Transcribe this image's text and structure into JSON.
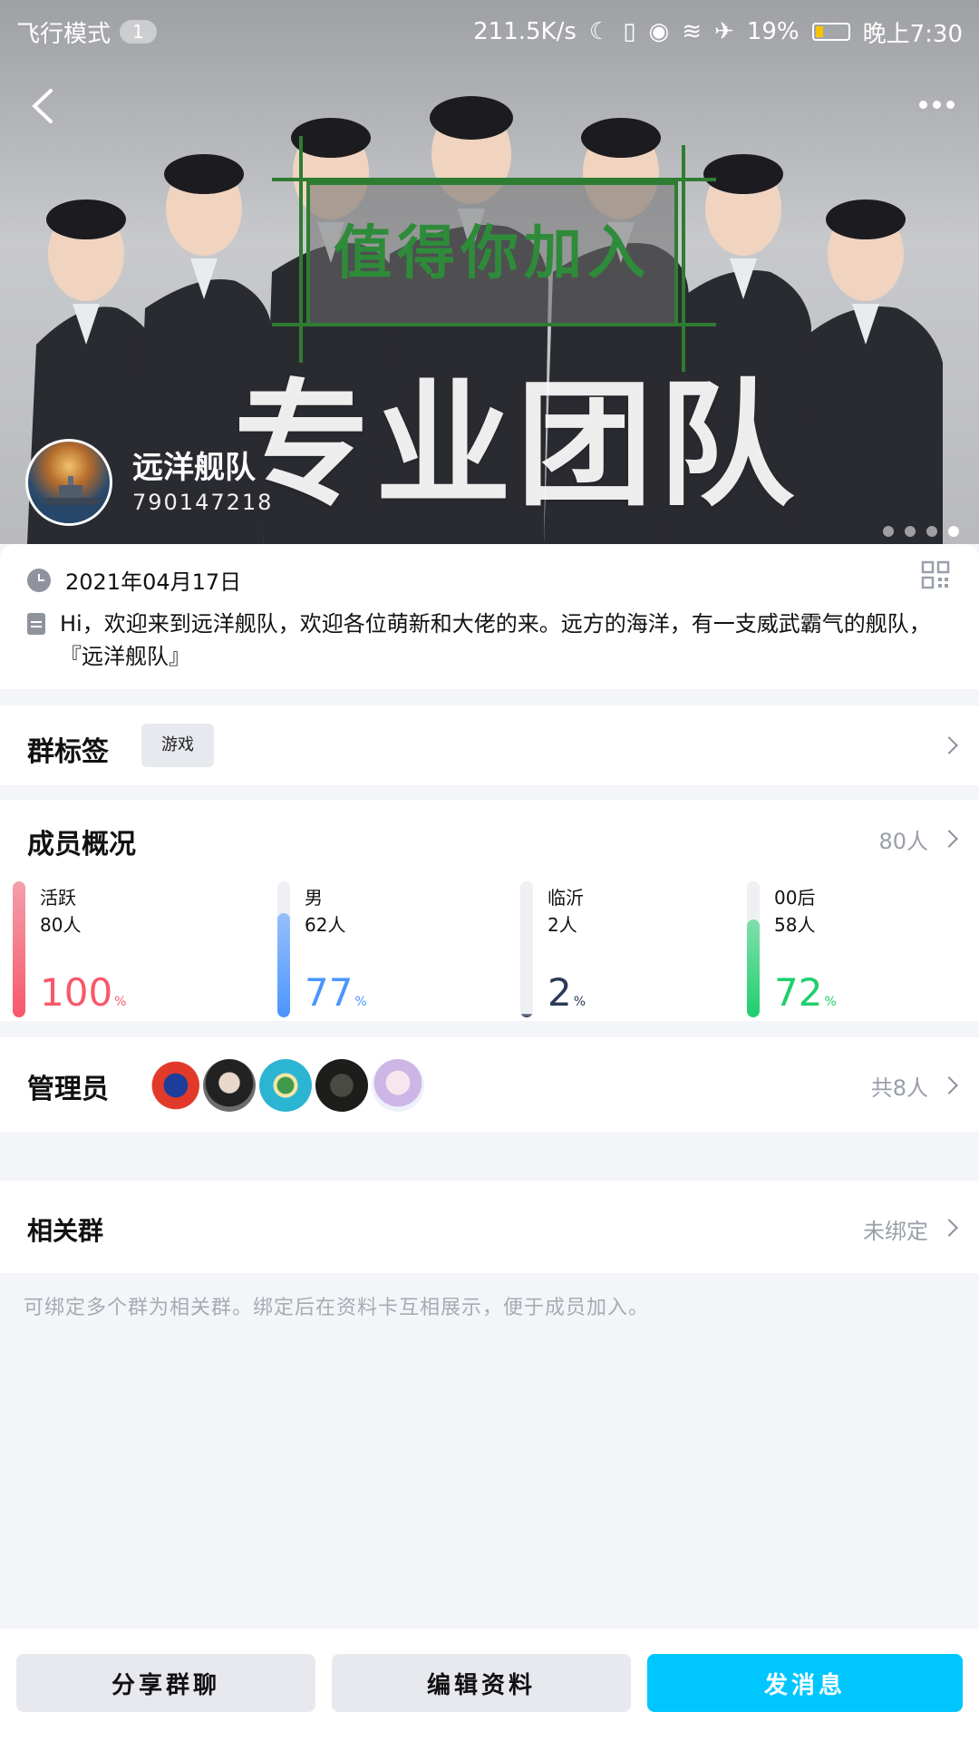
{
  "status_bar": {
    "mode_label": "飞行模式",
    "mode_badge": "1",
    "net_speed": "211.5K/s",
    "battery": "19%",
    "time": "晚上7:30"
  },
  "hero": {
    "banner_text": "值得你加入",
    "big_text": "专业团队",
    "page_dots": 4,
    "active_dot": 4
  },
  "group": {
    "name": "远洋舰队",
    "id": "790147218"
  },
  "info": {
    "date": "2021年04月17日",
    "description": "Hi，欢迎来到远洋舰队，欢迎各位萌新和大佬的来。远方的海洋，有一支威武霸气的舰队，『远洋舰队』"
  },
  "tags": {
    "label": "群标签",
    "items": [
      "游戏"
    ]
  },
  "members": {
    "label": "成员概况",
    "total": "80人",
    "stats": [
      {
        "name": "活跃",
        "count": "80人",
        "percent": 100,
        "pct_text": "100",
        "color": "#f8586a"
      },
      {
        "name": "男",
        "count": "62人",
        "percent": 77,
        "pct_text": "77",
        "color": "#4b95ff"
      },
      {
        "name": "临沂",
        "count": "2人",
        "percent": 2,
        "pct_text": "2",
        "color": "#2b3a56"
      },
      {
        "name": "00后",
        "count": "58人",
        "percent": 72,
        "pct_text": "72",
        "color": "#1fcf6d"
      }
    ],
    "pct_unit": "%"
  },
  "admins": {
    "label": "管理员",
    "count": "共8人"
  },
  "related": {
    "label": "相关群",
    "status": "未绑定",
    "hint": "可绑定多个群为相关群。绑定后在资料卡互相展示，便于成员加入。"
  },
  "actions": {
    "share": "分享群聊",
    "edit": "编辑资料",
    "send": "发消息"
  },
  "colors": {
    "primary": "#00c6ff",
    "banner_green": "#2e8b3a"
  }
}
